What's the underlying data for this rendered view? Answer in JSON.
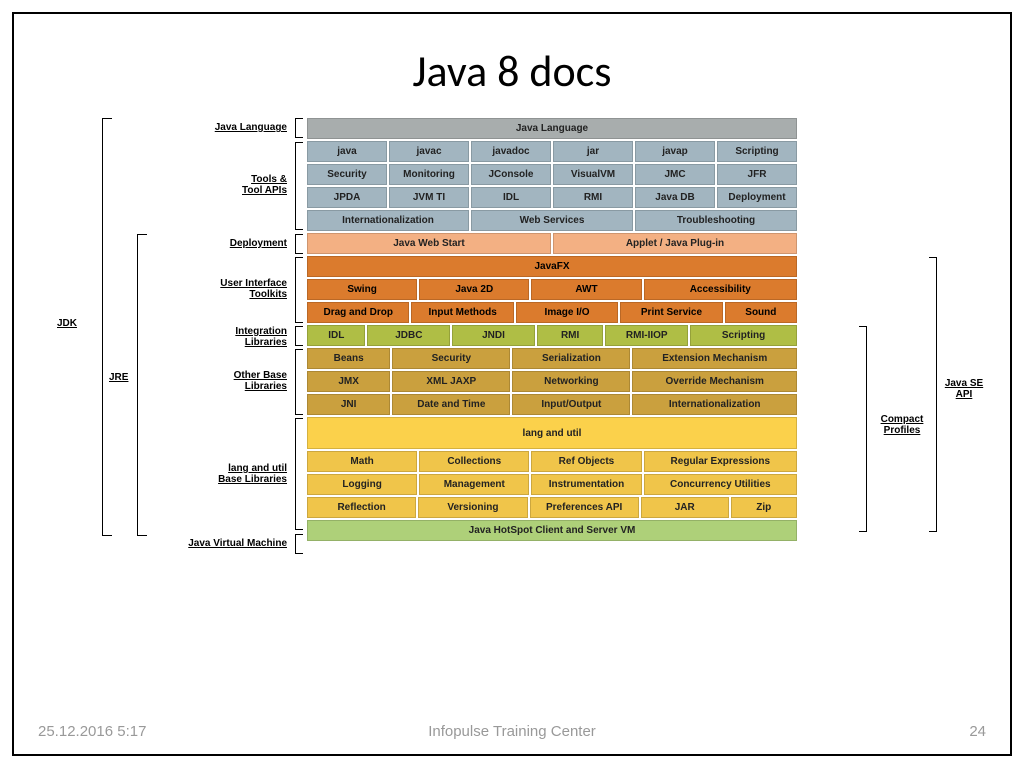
{
  "title": "Java 8 docs",
  "footer": {
    "date": "25.12.2016 5:17",
    "org": "Infopulse Training Center",
    "page": "24"
  },
  "left": {
    "jdk": "JDK",
    "jre": "JRE",
    "javalang": "Java Language",
    "tools": "Tools &\nTool APIs",
    "deploy": "Deployment",
    "ui": "User Interface\nToolkits",
    "integ": "Integration\nLibraries",
    "other": "Other Base\nLibraries",
    "langutil": "lang and util\nBase Libraries",
    "jvm": "Java Virtual Machine"
  },
  "right": {
    "compact": "Compact\nProfiles",
    "javase": "Java SE\nAPI"
  },
  "rows": {
    "r0": [
      "Java Language"
    ],
    "r1": [
      "java",
      "javac",
      "javadoc",
      "jar",
      "javap",
      "Scripting"
    ],
    "r2": [
      "Security",
      "Monitoring",
      "JConsole",
      "VisualVM",
      "JMC",
      "JFR"
    ],
    "r3": [
      "JPDA",
      "JVM TI",
      "IDL",
      "RMI",
      "Java DB",
      "Deployment"
    ],
    "r4": [
      "Internationalization",
      "Web Services",
      "Troubleshooting"
    ],
    "r5": [
      "Java Web Start",
      "Applet / Java Plug-in"
    ],
    "r6": [
      "JavaFX"
    ],
    "r7": [
      "Swing",
      "Java 2D",
      "AWT",
      "Accessibility"
    ],
    "r8": [
      "Drag and Drop",
      "Input Methods",
      "Image I/O",
      "Print Service",
      "Sound"
    ],
    "r9": [
      "IDL",
      "JDBC",
      "JNDI",
      "RMI",
      "RMI-IIOP",
      "Scripting"
    ],
    "r10": [
      "Beans",
      "Security",
      "Serialization",
      "Extension Mechanism"
    ],
    "r11": [
      "JMX",
      "XML JAXP",
      "Networking",
      "Override Mechanism"
    ],
    "r12": [
      "JNI",
      "Date and Time",
      "Input/Output",
      "Internationalization"
    ],
    "r13": [
      "lang and util"
    ],
    "r14": [
      "Math",
      "Collections",
      "Ref Objects",
      "Regular Expressions"
    ],
    "r15": [
      "Logging",
      "Management",
      "Instrumentation",
      "Concurrency Utilities"
    ],
    "r16": [
      "Reflection",
      "Versioning",
      "Preferences API",
      "JAR",
      "Zip"
    ],
    "r17": [
      "Java HotSpot Client and Server VM"
    ]
  }
}
